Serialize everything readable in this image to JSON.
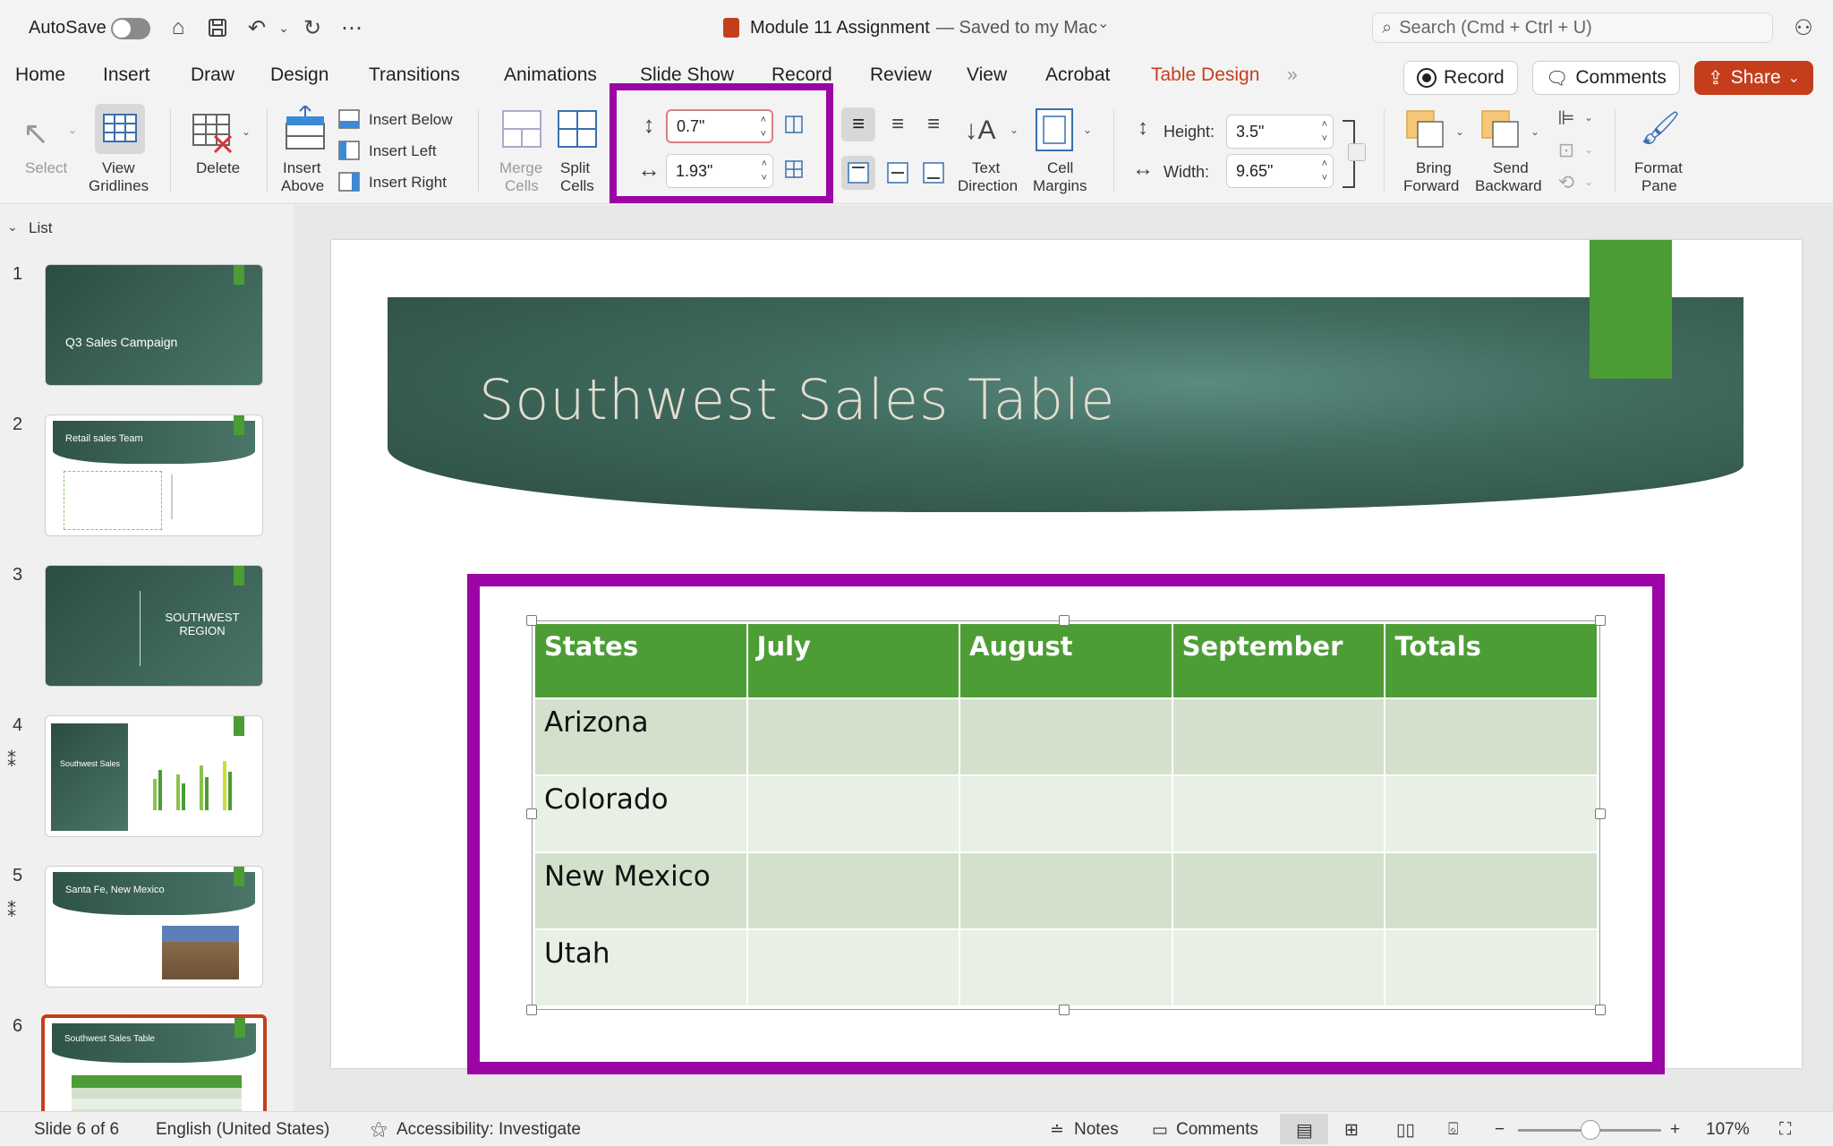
{
  "titlebar": {
    "autosave_label": "AutoSave",
    "doc_title": "Module 11 Assignment",
    "saved_status": "— Saved to my Mac",
    "search_placeholder": "Search (Cmd + Ctrl + U)"
  },
  "tabs": [
    "Home",
    "Insert",
    "Draw",
    "Design",
    "Transitions",
    "Animations",
    "Slide Show",
    "Record",
    "Review",
    "View",
    "Acrobat",
    "Table Design"
  ],
  "active_tab": "Table Design",
  "top_buttons": {
    "record": "Record",
    "comments": "Comments",
    "share": "Share"
  },
  "ribbon": {
    "select": "Select",
    "view_gridlines_1": "View",
    "view_gridlines_2": "Gridlines",
    "delete": "Delete",
    "insert_above_1": "Insert",
    "insert_above_2": "Above",
    "insert_below": "Insert Below",
    "insert_left": "Insert Left",
    "insert_right": "Insert Right",
    "merge_cells_1": "Merge",
    "merge_cells_2": "Cells",
    "split_cells_1": "Split",
    "split_cells_2": "Cells",
    "cell_height_value": "0.7\"",
    "cell_width_value": "1.93\"",
    "text_direction_1": "Text",
    "text_direction_2": "Direction",
    "cell_margins_1": "Cell",
    "cell_margins_2": "Margins",
    "height_label": "Height:",
    "height_value": "3.5\"",
    "width_label": "Width:",
    "width_value": "9.65\"",
    "bring_forward_1": "Bring",
    "bring_forward_2": "Forward",
    "send_backward_1": "Send",
    "send_backward_2": "Backward",
    "format_pane_1": "Format",
    "format_pane_2": "Pane"
  },
  "panel": {
    "header": "List",
    "thumbnails": [
      {
        "num": "1",
        "title": "Q3 Sales Campaign"
      },
      {
        "num": "2",
        "title": "Retail sales Team"
      },
      {
        "num": "3",
        "title": "SOUTHWEST REGION"
      },
      {
        "num": "4",
        "title": "Southwest Sales"
      },
      {
        "num": "5",
        "title": "Santa Fe, New Mexico"
      },
      {
        "num": "6",
        "title": "Southwest Sales Table"
      }
    ]
  },
  "slide": {
    "title": "Southwest Sales Table",
    "table": {
      "headers": [
        "States",
        "July",
        "August",
        "September",
        "Totals"
      ],
      "rows": [
        [
          "Arizona",
          "",
          "",
          "",
          ""
        ],
        [
          "Colorado",
          "",
          "",
          "",
          ""
        ],
        [
          "New Mexico",
          "",
          "",
          "",
          ""
        ],
        [
          "Utah",
          "",
          "",
          "",
          ""
        ]
      ]
    }
  },
  "status": {
    "slide_count": "Slide 6 of 6",
    "language": "English (United States)",
    "accessibility": "Accessibility: Investigate",
    "notes": "Notes",
    "comments": "Comments",
    "zoom": "107%"
  },
  "colors": {
    "accent": "#c43e1c",
    "highlight": "#9b05a6",
    "table_header": "#4d9d37",
    "table_row_odd": "#d3e1cc",
    "table_row_even": "#e8efe4"
  }
}
